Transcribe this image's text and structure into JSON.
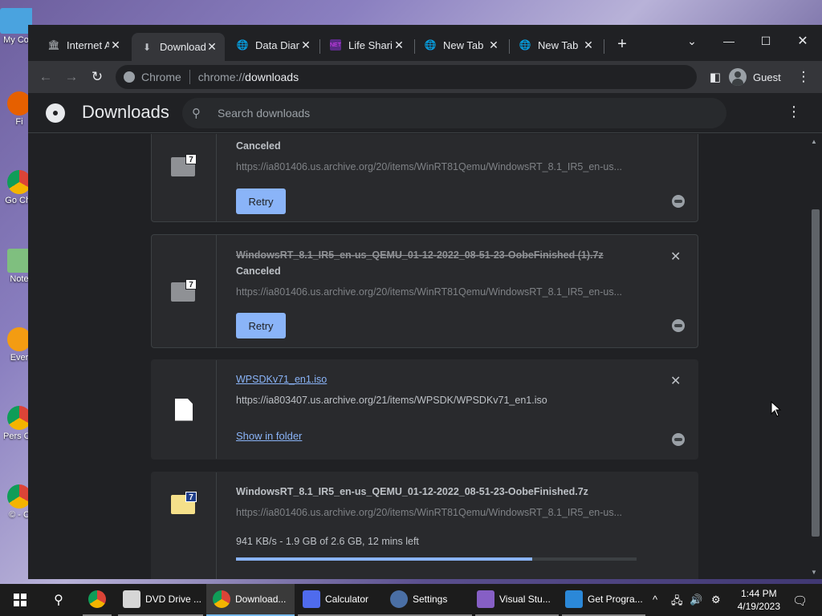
{
  "desktop": {
    "icons": [
      {
        "label": "My Co",
        "icon": "computer-icon",
        "color": "#4aa3df"
      },
      {
        "label": "Fi",
        "icon": "firefox-icon",
        "color": "#e66000"
      },
      {
        "label": "Go Chr",
        "icon": "chrome-icon",
        "color": "#1da462"
      },
      {
        "label": "Note",
        "icon": "notepad-icon",
        "color": "#7fbf7f"
      },
      {
        "label": "Ever",
        "icon": "everything-icon",
        "color": "#f39c12"
      },
      {
        "label": "Pers Chr",
        "icon": "chrome-icon",
        "color": "#1da462"
      },
      {
        "label": "© - C",
        "icon": "chrome-icon",
        "color": "#1da462"
      }
    ]
  },
  "tabs": [
    {
      "title": "Internet A",
      "icon": "museum-icon",
      "active": false
    },
    {
      "title": "Download",
      "icon": "download-icon",
      "active": true
    },
    {
      "title": "Data Dian",
      "icon": "globe-icon",
      "active": false
    },
    {
      "title": "Life Sharin",
      "icon": "netart-icon",
      "active": false
    },
    {
      "title": "New Tab",
      "icon": "globe-icon",
      "active": false
    },
    {
      "title": "New Tab",
      "icon": "globe-icon",
      "active": false
    }
  ],
  "omnibox": {
    "site_label": "Chrome",
    "scheme": "chrome://",
    "host": "downloads"
  },
  "profile": {
    "name": "Guest"
  },
  "downloads_page": {
    "title": "Downloads",
    "search_placeholder": "Search downloads"
  },
  "downloads": [
    {
      "filename": "",
      "status": "Canceled",
      "url": "https://ia801406.us.archive.org/20/items/WinRT81Qemu/WindowsRT_8.1_IR5_en-us...",
      "action": "Retry",
      "type": "7z-canceled"
    },
    {
      "filename": "WindowsRT_8.1_IR5_en-us_QEMU_01-12-2022_08-51-23-OobeFinished (1).7z",
      "status": "Canceled",
      "url": "https://ia801406.us.archive.org/20/items/WinRT81Qemu/WindowsRT_8.1_IR5_en-us...",
      "action": "Retry",
      "type": "7z-canceled"
    },
    {
      "filename": "WPSDKv71_en1.iso",
      "status": "",
      "url": "https://ia803407.us.archive.org/21/items/WPSDK/WPSDKv71_en1.iso",
      "action": "Show in folder",
      "type": "iso-complete"
    },
    {
      "filename": "WindowsRT_8.1_IR5_en-us_QEMU_01-12-2022_08-51-23-OobeFinished.7z",
      "status": "",
      "url": "https://ia801406.us.archive.org/20/items/WinRT81Qemu/WindowsRT_8.1_IR5_en-us...",
      "progress_text": "941 KB/s - 1.9 GB of 2.6 GB, 12 mins left",
      "progress": 0.74,
      "type": "7z-inprogress"
    }
  ],
  "taskbar": {
    "items": [
      {
        "label": "",
        "icon": "chrome-icon",
        "color": "#1da462"
      },
      {
        "label": "DVD Drive ...",
        "icon": "explorer-icon",
        "color": "#f0c419"
      },
      {
        "label": "Download...",
        "icon": "chrome-icon",
        "color": "#1da462"
      },
      {
        "label": "Calculator",
        "icon": "calculator-icon",
        "color": "#4f6bed"
      },
      {
        "label": "Settings",
        "icon": "gear-icon",
        "color": "#4a6fa5"
      },
      {
        "label": "Visual Stu...",
        "icon": "visual-studio-icon",
        "color": "#865fc5"
      },
      {
        "label": "Get Progra...",
        "icon": "programs-icon",
        "color": "#2b88d8"
      }
    ],
    "time": "1:44 PM",
    "date": "4/19/2023"
  }
}
